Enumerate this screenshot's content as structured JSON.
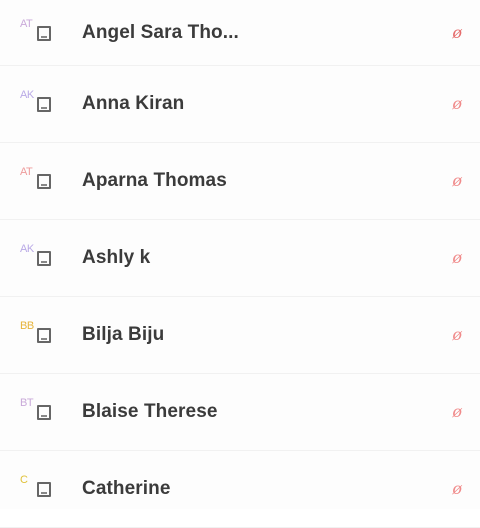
{
  "contacts": [
    {
      "initials": "AT",
      "name": "Angel Sara Tho...",
      "initials_color": "#c9a9d9",
      "action_color": "#e56b6b"
    },
    {
      "initials": "AK",
      "name": "Anna Kiran",
      "initials_color": "#b9a9e6",
      "action_color": "#f08a8a"
    },
    {
      "initials": "AT",
      "name": "Aparna Thomas",
      "initials_color": "#ee9b9b",
      "action_color": "#f08a8a"
    },
    {
      "initials": "AK",
      "name": "Ashly k",
      "initials_color": "#b9a9e6",
      "action_color": "#f08a8a"
    },
    {
      "initials": "BB",
      "name": "Bilja Biju",
      "initials_color": "#e6b43b",
      "action_color": "#f08a8a"
    },
    {
      "initials": "BT",
      "name": "Blaise Therese",
      "initials_color": "#c9a9d9",
      "action_color": "#f08a8a"
    },
    {
      "initials": "C",
      "name": "Catherine",
      "initials_color": "#e0c23b",
      "action_color": "#f08a8a"
    }
  ],
  "icons": {
    "device": "device-icon",
    "action": "edit-icon"
  }
}
